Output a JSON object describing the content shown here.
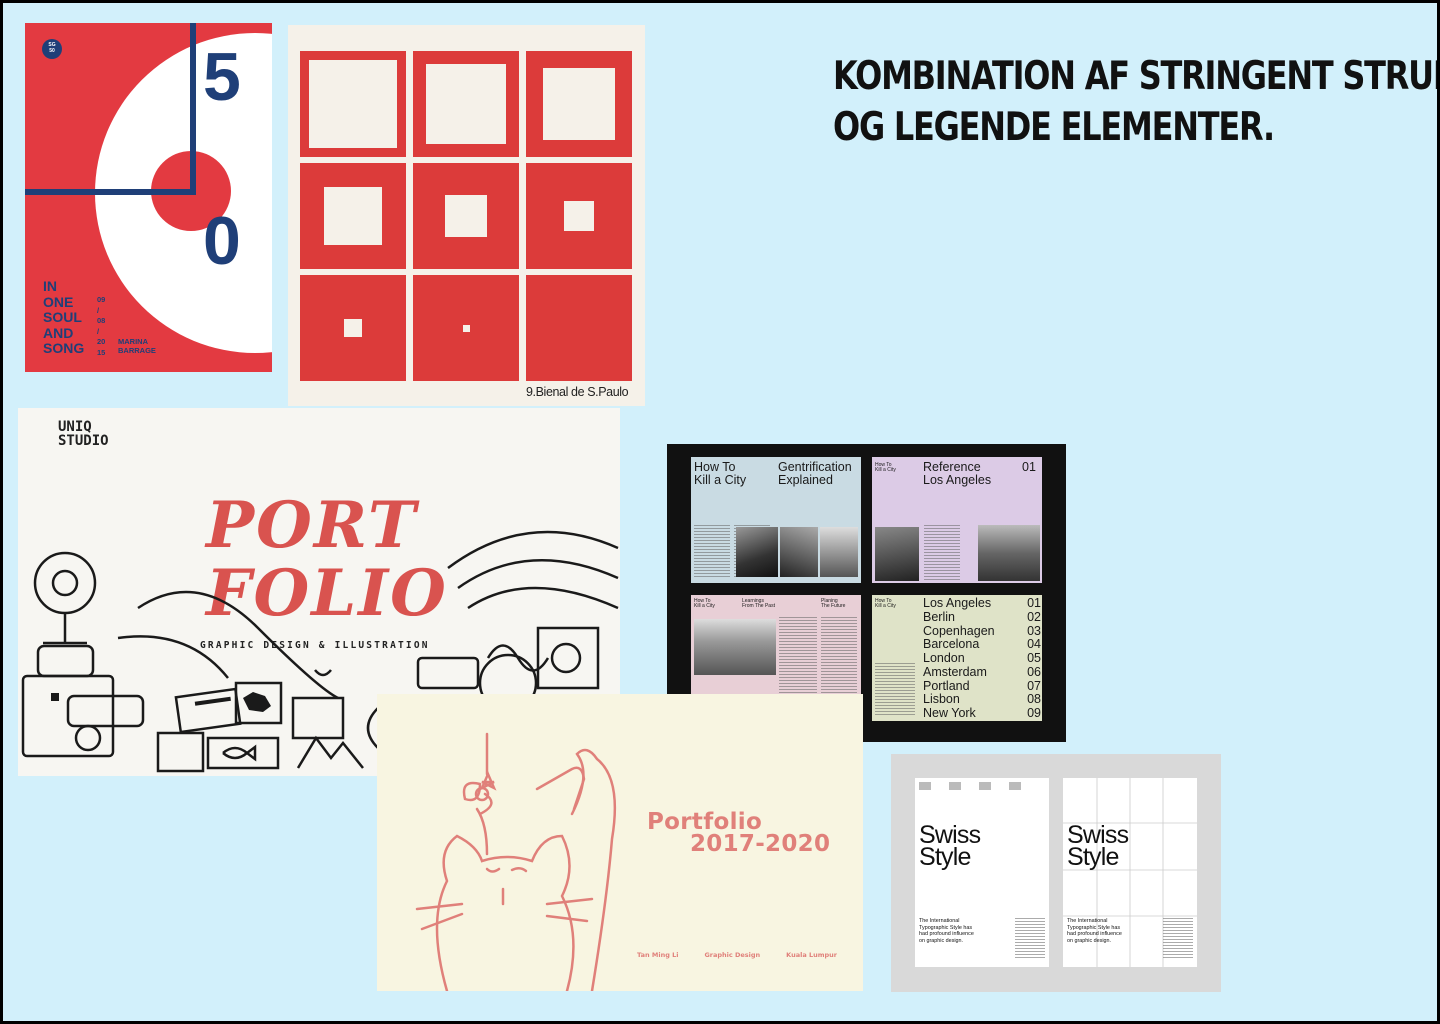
{
  "heading": {
    "line1": "Kombination af stringent struktur",
    "line2": "og legende elementer."
  },
  "poster_50": {
    "badge_top": "SG",
    "badge_bottom": "50",
    "digit_top": "5",
    "digit_bottom": "0",
    "words": [
      "IN",
      "ONE",
      "SOUL",
      "AND",
      "SONG"
    ],
    "date_parts": [
      "09",
      "/",
      "08",
      "/",
      "20",
      "15"
    ],
    "name_line1": "MARINA",
    "name_line2": "BARRAGE",
    "colors": {
      "background": "#e33a41",
      "navy": "#1f3f78",
      "white": "#ffffff"
    }
  },
  "poster_bienal": {
    "caption": "9.Bienal de S.Paulo",
    "colors": {
      "square": "#dc3b3a",
      "paper": "#f5f1e9"
    }
  },
  "poster_uniq": {
    "brand_line1": "UNIQ",
    "brand_line2": "STUDIO",
    "title_line1": "PORT",
    "title_line2": "FOLIO",
    "subtitle": "GRAPHIC DESIGN & ILLUSTRATION",
    "colors": {
      "title": "#d9534f"
    }
  },
  "poster_city": {
    "page1": {
      "title_a_line1": "How To",
      "title_a_line2": "Kill a City",
      "title_b_line1": "Gentrification",
      "title_b_line2": "Explained"
    },
    "page2": {
      "small_line1": "How To",
      "small_line2": "Kill a City",
      "title_line1": "Reference",
      "title_line2": "Los Angeles",
      "number": "01"
    },
    "page3": {
      "label_a_line1": "How To",
      "label_a_line2": "Kill a City",
      "label_b_line1": "Learnings",
      "label_b_line2": "From The Past",
      "label_c_line1": "Planing",
      "label_c_line2": "The Future"
    },
    "page4": {
      "small_line1": "How To",
      "small_line2": "Kill a City",
      "cities": [
        {
          "name": "Los Angeles",
          "num": "01"
        },
        {
          "name": "Berlin",
          "num": "02"
        },
        {
          "name": "Copenhagen",
          "num": "03"
        },
        {
          "name": "Barcelona",
          "num": "04"
        },
        {
          "name": "London",
          "num": "05"
        },
        {
          "name": "Amsterdam",
          "num": "06"
        },
        {
          "name": "Portland",
          "num": "07"
        },
        {
          "name": "Lisbon",
          "num": "08"
        },
        {
          "name": "New York",
          "num": "09"
        }
      ]
    },
    "colors": {
      "page1": "#c9dbe3",
      "page2": "#dccbe6",
      "page3": "#e8cfd6",
      "page4": "#dfe3c8"
    }
  },
  "poster_cat": {
    "title_line1": "Portfolio",
    "title_line2": "2017-2020",
    "footer": [
      "Tan Ming Li",
      "Graphic Design",
      "Kuala Lumpur"
    ],
    "colors": {
      "accent": "#e0807a",
      "paper": "#f8f5e1"
    }
  },
  "poster_swiss": {
    "title_line1": "Swiss",
    "title_line2": "Style",
    "caption": "The International Typographic Style has had profound influence on graphic design."
  }
}
